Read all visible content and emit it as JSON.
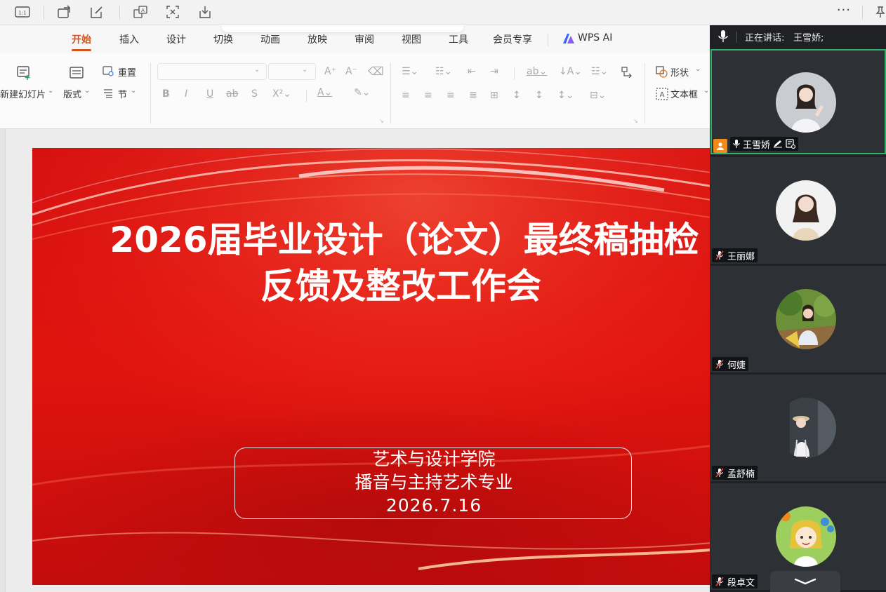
{
  "menu": {
    "tabs": [
      "开始",
      "插入",
      "设计",
      "切换",
      "动画",
      "放映",
      "审阅",
      "视图",
      "工具",
      "会员专享"
    ],
    "ai_label": "WPS AI"
  },
  "ribbon": {
    "new_slide": "新建幻灯片",
    "layout": "版式",
    "reset": "重置",
    "section": "节",
    "shape": "形状",
    "textbox": "文本框"
  },
  "slide": {
    "title_line1": "2026届毕业设计（论文）最终稿抽检",
    "title_line2": "反馈及整改工作会",
    "sub_line1": "艺术与设计学院",
    "sub_line2": "播音与主持艺术专业",
    "sub_line3": "2026.7.16"
  },
  "meeting": {
    "speaking_label": "正在讲话:",
    "speaking_name": "王雪娇;",
    "participants": [
      {
        "name": "王雪娇"
      },
      {
        "name": "王丽娜"
      },
      {
        "name": "何婕"
      },
      {
        "name": "孟舒楠"
      },
      {
        "name": "段卓文"
      }
    ]
  },
  "colors": {
    "accent": "#d2541f",
    "slide_red": "#d50f0f",
    "active_border": "#2fb36a",
    "panel_bg": "#1f2124",
    "tile_bg": "#2d3034"
  }
}
